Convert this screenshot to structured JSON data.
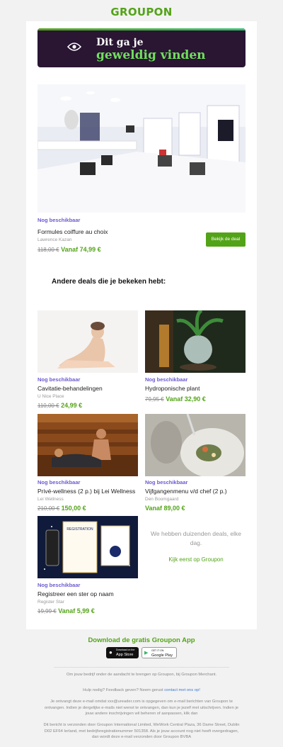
{
  "brand": {
    "logo": "GROUPON"
  },
  "hero": {
    "line1": "Dit ga je",
    "line2": "geweldig vinden"
  },
  "main_deal": {
    "badge": "Nog beschikbaar",
    "title": "Formules coiffure au choix",
    "merchant": "Lawrence Kazan",
    "old_price": "118,00 €",
    "new_price": "Vanaf 74,99 €",
    "button": "Bekijk de deal"
  },
  "section": {
    "title": "Andere deals die je bekeken hebt:"
  },
  "deals": [
    {
      "badge": "Nog beschikbaar",
      "title": "Cavitatie-behandelingen",
      "merchant": "U Nice Place",
      "old_price": "110,00 €",
      "new_price": "24,99 €"
    },
    {
      "badge": "Nog beschikbaar",
      "title": "Hydroponische plant",
      "merchant": "",
      "old_price": "79,95 €",
      "new_price": "Vanaf 32,90 €"
    },
    {
      "badge": "Nog beschikbaar",
      "title": "Privé-wellness (2 p.) bij Lei Wellness",
      "merchant": "Lei Wellness",
      "old_price": "210,00 €",
      "new_price": "150,00 €"
    },
    {
      "badge": "Nog beschikbaar",
      "title": "Vijfgangenmenu v/d chef (2 p.)",
      "merchant": "Den Boomgaard",
      "old_price": "",
      "new_price": "Vanaf 89,00 €"
    },
    {
      "badge": "Nog beschikbaar",
      "title": "Registreer een ster op naam",
      "merchant": "Register Star",
      "old_price": "19,99 €",
      "new_price": "Vanaf 5,99 €"
    }
  ],
  "star_image": {
    "label": "REGISTRATION"
  },
  "promo": {
    "text": "We hebben duizenden deals, elke dag.",
    "link": "Kijk eerst op Groupon"
  },
  "app": {
    "title": "Download de gratis Groupon App",
    "appstore_small": "Download on the",
    "appstore": "App Store",
    "googleplay_small": "GET IT ON",
    "googleplay": "Google Play"
  },
  "footer": {
    "line1": "Om jouw bedrijf onder de aandacht te brengen op Groupon, bij Groupon Merchant.",
    "help_prefix": "Hulp nodig? Feedback geven? Neem gerust",
    "help_link": "contact met ons op!",
    "line3": "Je ontvangt deze e-mail omdat xxx@ureader.com is opgegeven om e-mail berichten van Groupon te ontvangen. Indien je dergelijke e-mails niet wenst te ontvangen, dan kun je jezelf met uitschrijven. Indien je jouw andere inschrijvingen wil beheren of aanpassen, klik dan",
    "line4": "Dit bericht is verzonden door Groupon International Limited, WeWork Central Plaza, 36 Dame Street, Dublin D02 EF64 Ierland, met bedrijfsregistratienummer 501358. Als je jouw account nog niet heeft overgedragen, dan wordt deze e-mail verzonden door Groupon BVBA"
  }
}
